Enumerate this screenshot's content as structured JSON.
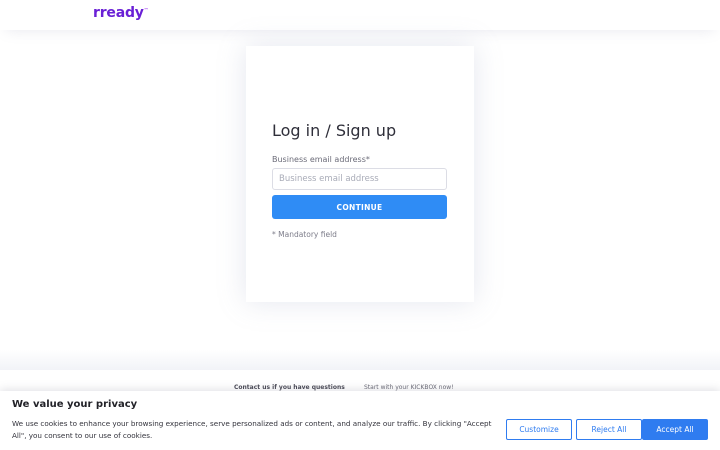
{
  "header": {
    "logo_text": "rready",
    "logo_mark": "™"
  },
  "login": {
    "title": "Log in / Sign up",
    "email_label": "Business email address*",
    "email_placeholder": "Business email address",
    "email_value": "",
    "continue_label": "CONTINUE",
    "mandatory_note": "* Mandatory field"
  },
  "footer": {
    "contact_link": "Contact us if you have questions",
    "kickbox_link": "Start with your KICKBOX now!"
  },
  "cookie_banner": {
    "title": "We value your privacy",
    "text": "We use cookies to enhance your browsing experience, serve personalized ads or content, and analyze our traffic. By clicking \"Accept All\", you consent to our use of cookies.",
    "customize_label": "Customize",
    "reject_label": "Reject All",
    "accept_label": "Accept All"
  },
  "colors": {
    "brand_purple": "#6a20d6",
    "primary_blue": "#2f8cf5",
    "cookie_blue": "#2f7cf0"
  }
}
